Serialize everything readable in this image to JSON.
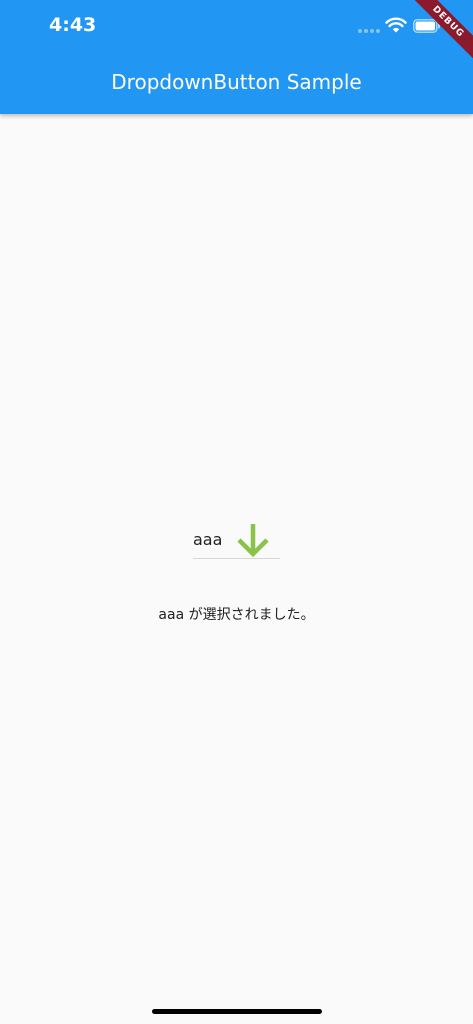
{
  "status_bar": {
    "time": "4:43",
    "icons": [
      "signal-icon",
      "wifi-icon",
      "battery-icon"
    ]
  },
  "app_bar": {
    "title": "DropdownButton Sample",
    "color": "#2196f3"
  },
  "debug_banner": {
    "label": "DEBUG"
  },
  "dropdown": {
    "selected_value": "aaa",
    "icon": "arrow-down-icon",
    "icon_color": "#8bc34a"
  },
  "result": {
    "text": "aaa が選択されました。"
  }
}
